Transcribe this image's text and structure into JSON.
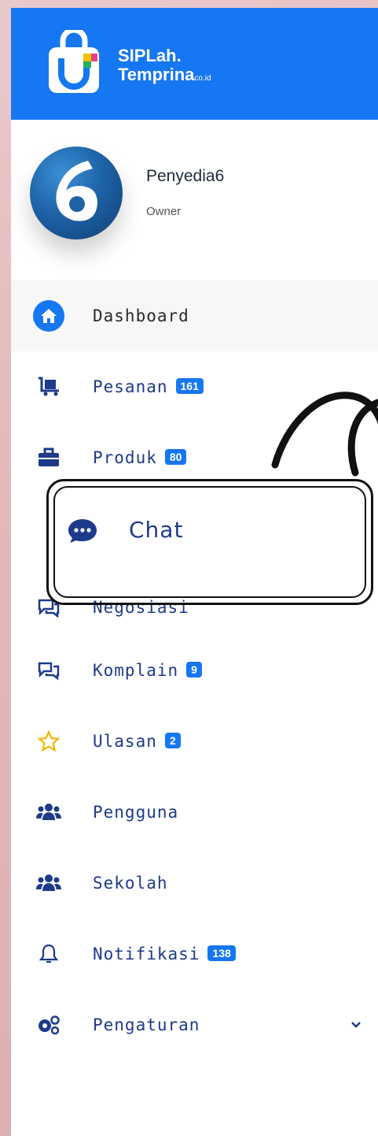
{
  "brand": {
    "line1": "SIPLah.",
    "line2": "Temprina",
    "suffix": "co.id",
    "color": "#1677f2"
  },
  "profile": {
    "name": "Penyedia6",
    "role": "Owner",
    "avatar_digit": "6"
  },
  "menu": {
    "items": [
      {
        "label": "Dashboard",
        "icon": "home-icon"
      },
      {
        "label": "Pesanan",
        "badge": "161",
        "icon": "cart-icon"
      },
      {
        "label": "Produk",
        "badge": "80",
        "icon": "briefcase-icon"
      },
      {
        "label": "Chat",
        "icon": "chat-bubble-icon"
      },
      {
        "label": "Negosiasi",
        "icon": "negotiation-icon"
      },
      {
        "label": "Komplain",
        "badge": "9",
        "icon": "complaint-icon"
      },
      {
        "label": "Ulasan",
        "badge": "2",
        "icon": "star-icon"
      },
      {
        "label": "Pengguna",
        "icon": "users-icon"
      },
      {
        "label": "Sekolah",
        "icon": "school-users-icon"
      },
      {
        "label": "Notifikasi",
        "badge": "138",
        "icon": "bell-icon"
      },
      {
        "label": "Pengaturan",
        "icon": "gears-icon"
      }
    ]
  },
  "colors": {
    "accent": "#1677f2",
    "label": "#1e3a8a",
    "star": "#f2b705"
  }
}
